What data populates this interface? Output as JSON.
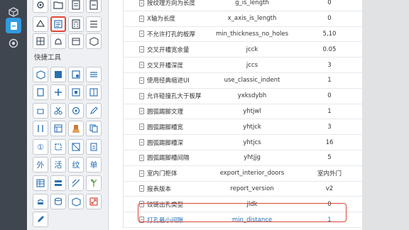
{
  "toolpanel": {
    "quick_tools_label": "快捷工具",
    "text_tools": [
      "外",
      "活",
      "纹",
      "单"
    ],
    "circle_tool": "①"
  },
  "params": [
    {
      "name": "按纹理方向为长度",
      "key": "g_is_length",
      "value": "0"
    },
    {
      "name": "X轴为长度",
      "key": "x_axis_is_length",
      "value": "0"
    },
    {
      "name": "不允许打孔的板厚",
      "key": "min_thickness_no_holes",
      "value": "5,10"
    },
    {
      "name": "交叉开槽宽余量",
      "key": "jcck",
      "value": "0.05"
    },
    {
      "name": "交叉开槽深度",
      "key": "jccs",
      "value": "3"
    },
    {
      "name": "使用经典缩进UI",
      "key": "use_classic_indent",
      "value": "1"
    },
    {
      "name": "允许碰撞孔大于板厚",
      "key": "yxksdybh",
      "value": "0"
    },
    {
      "name": "圆弧踢脚文理",
      "key": "yhtjwl",
      "value": "1"
    },
    {
      "name": "圆弧踢脚槽宽",
      "key": "yhtjck",
      "value": "3"
    },
    {
      "name": "圆弧踢脚槽深",
      "key": "yhtjcs",
      "value": "16"
    },
    {
      "name": "圆弧踢脚槽间隔",
      "key": "yhtjjg",
      "value": "5"
    },
    {
      "name": "室内门柜体",
      "key": "export_interior_doors",
      "value": "室内外门"
    },
    {
      "name": "报表版本",
      "key": "report_version",
      "value": "v2"
    },
    {
      "name": "铰链出孔类型",
      "key": "jldk",
      "value": "0"
    },
    {
      "name": "打孔最小间隙",
      "key": "min_distance",
      "value": "1"
    }
  ],
  "colors": {
    "accent": "#2f9be0",
    "highlight": "#d9463a",
    "link": "#2a6fb0"
  }
}
